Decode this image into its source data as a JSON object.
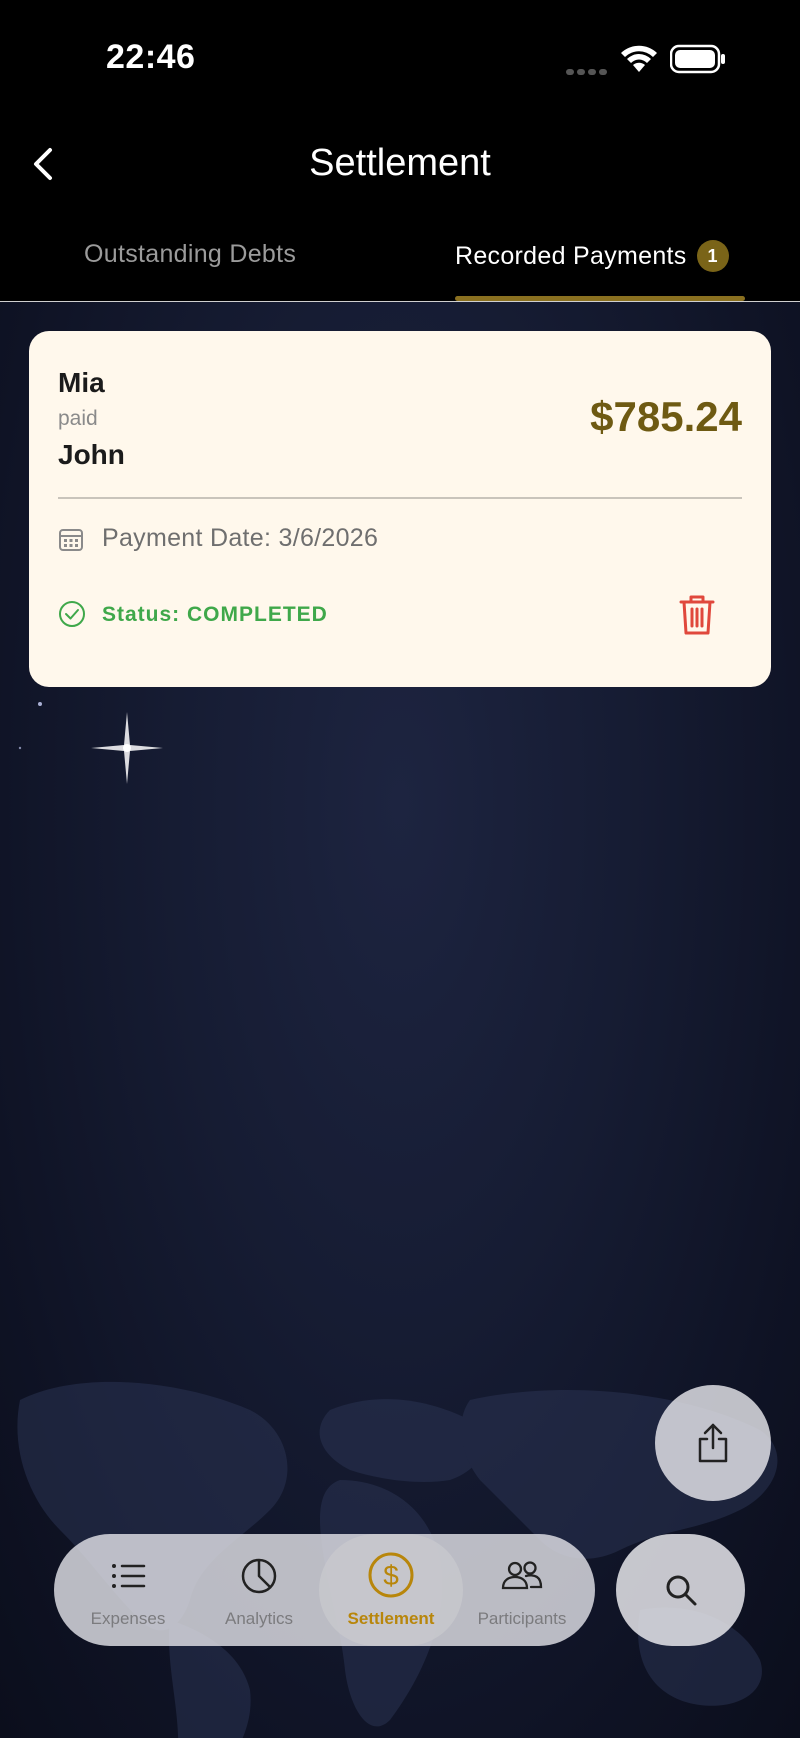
{
  "status_bar": {
    "time": "22:46"
  },
  "nav": {
    "title": "Settlement",
    "back_icon": "chevron-left-icon"
  },
  "tabs": {
    "outstanding": "Outstanding Debts",
    "recorded": "Recorded Payments",
    "recorded_badge": "1"
  },
  "payment": {
    "payer": "Mia",
    "verb": "paid",
    "payee": "John",
    "amount": "$785.24",
    "date_label": "Payment Date: 3/6/2026",
    "status_label": "Status: COMPLETED"
  },
  "tabbar": {
    "items": [
      {
        "label": "Expenses",
        "icon": "list-icon"
      },
      {
        "label": "Analytics",
        "icon": "pie-chart-icon"
      },
      {
        "label": "Settlement",
        "icon": "dollar-circle-icon"
      },
      {
        "label": "Participants",
        "icon": "people-icon"
      }
    ],
    "active": "Settlement"
  },
  "colors": {
    "accent_gold": "#8a7020",
    "amount": "#6e5a12",
    "status_green": "#3fa84a",
    "delete_red": "#e0483c",
    "card_bg": "#fff8ec"
  }
}
